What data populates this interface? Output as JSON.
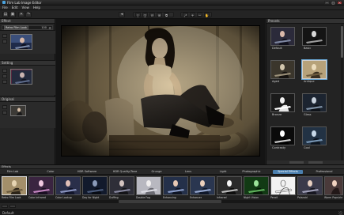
{
  "window": {
    "title": "Film Lab Image Editor",
    "status": "Default"
  },
  "menu": [
    "File",
    "Edit",
    "View",
    "Help"
  ],
  "left_panel": {
    "preset_header": "Effect",
    "preset_name": "Retro Film Look",
    "preset_value": "100",
    "section2_header": "Setting",
    "section3_header": "Original"
  },
  "right_panel": {
    "header": "Presets",
    "tiles": [
      {
        "label": "Default"
      },
      {
        "label": "Basic"
      },
      {
        "label": "Aged"
      },
      {
        "label": "Antique"
      },
      {
        "label": "Bronze"
      },
      {
        "label": "Glass"
      },
      {
        "label": "Contrasty"
      },
      {
        "label": "Cool"
      }
    ]
  },
  "bottom_panel": {
    "header": "Effects",
    "tabs": [
      {
        "label": "Film Lab",
        "active": false
      },
      {
        "label": "Color",
        "active": false
      },
      {
        "label": "HDR Software",
        "active": false
      },
      {
        "label": "HDR Quality/Tone",
        "active": false
      },
      {
        "label": "Grunge",
        "active": false
      },
      {
        "label": "Lens",
        "active": false
      },
      {
        "label": "Light",
        "active": false
      },
      {
        "label": "Photographic",
        "active": false
      },
      {
        "label": "Special Effects",
        "active": true
      },
      {
        "label": "Professional",
        "active": false
      }
    ],
    "thumbs": [
      {
        "label": "Retro Film Look"
      },
      {
        "label": "Color Infrared"
      },
      {
        "label": "Color Lookup"
      },
      {
        "label": "Day for Night"
      },
      {
        "label": "Duffing"
      },
      {
        "label": "Double Fog"
      },
      {
        "label": "Enhancing"
      },
      {
        "label": "Enhancer"
      },
      {
        "label": "Infrared"
      },
      {
        "label": "Night Vision"
      },
      {
        "label": "Pencil"
      },
      {
        "label": "Polaroid"
      },
      {
        "label": "Warm Popsicle"
      }
    ]
  },
  "colors": {
    "accent": "#4b7fae",
    "panel": "#232323",
    "sepia_light": "#d8c7a2",
    "sepia_dark": "#2e261a"
  }
}
